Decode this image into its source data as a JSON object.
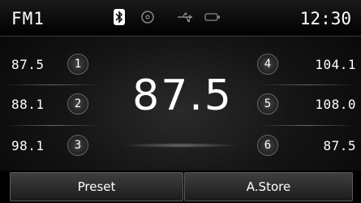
{
  "status": {
    "band": "FM1",
    "time": "12:30",
    "icons": [
      "bluetooth-icon",
      "disc-icon",
      "usb-icon",
      "ipod-icon"
    ]
  },
  "main_frequency": "87.5",
  "presets_left": [
    {
      "freq": "87.5",
      "num": "1"
    },
    {
      "freq": "88.1",
      "num": "2"
    },
    {
      "freq": "98.1",
      "num": "3"
    }
  ],
  "presets_right": [
    {
      "freq": "104.1",
      "num": "4"
    },
    {
      "freq": "108.0",
      "num": "5"
    },
    {
      "freq": "87.5",
      "num": "6"
    }
  ],
  "buttons": {
    "preset": "Preset",
    "astore": "A.Store"
  }
}
